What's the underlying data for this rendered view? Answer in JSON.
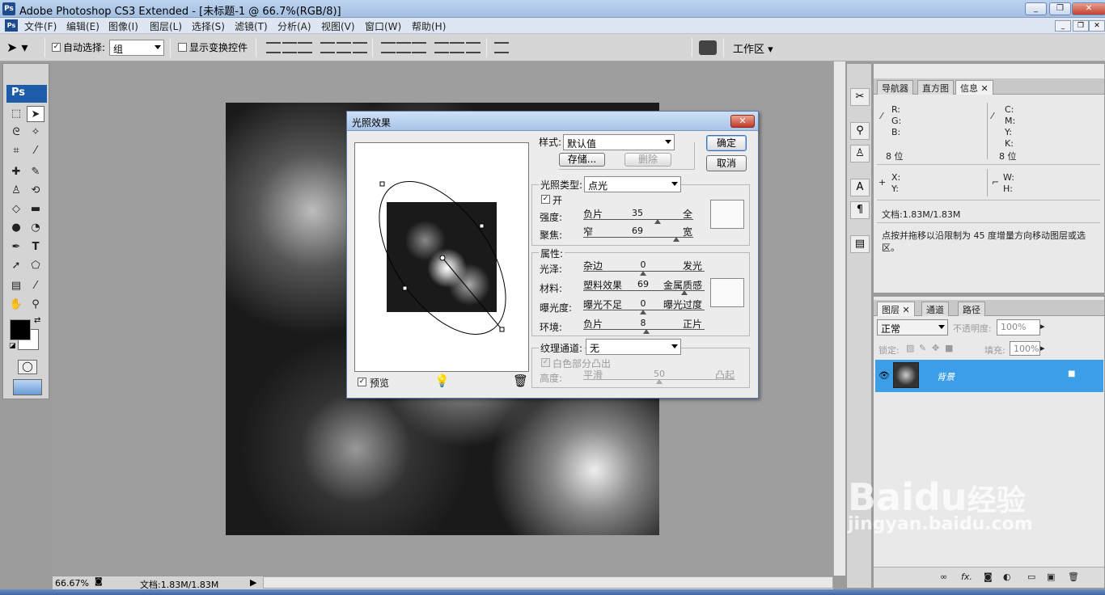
{
  "window": {
    "title": "Adobe Photoshop CS3 Extended - [未标题-1 @ 66.7%(RGB/8)]",
    "app_icon": "Ps",
    "controls": [
      "_",
      "❐",
      "✕"
    ]
  },
  "menu": {
    "items": [
      "文件(F)",
      "编辑(E)",
      "图像(I)",
      "图层(L)",
      "选择(S)",
      "滤镜(T)",
      "分析(A)",
      "视图(V)",
      "窗口(W)",
      "帮助(H)"
    ],
    "doc_controls": [
      "_",
      "❐",
      "✕"
    ]
  },
  "options": {
    "auto_select_label": "自动选择:",
    "auto_select_checked": true,
    "auto_select_value": "组",
    "show_transform_label": "显示变换控件",
    "show_transform_checked": false,
    "workspace_label": "工作区"
  },
  "tools": {
    "ps_logo": "Ps"
  },
  "status": {
    "zoom": "66.67%",
    "doc_info": "文档:1.83M/1.83M"
  },
  "panel_info": {
    "tabs": [
      "导航器",
      "直方图",
      "信息"
    ],
    "active_tab": "信息",
    "rgb_labels": [
      "R:",
      "G:",
      "B:"
    ],
    "cmyk_labels": [
      "C:",
      "M:",
      "Y:",
      "K:"
    ],
    "bit_left": "8 位",
    "bit_right": "8 位",
    "xy_labels": [
      "X:",
      "Y:"
    ],
    "wh_labels": [
      "W:",
      "H:"
    ],
    "doc": "文档:1.83M/1.83M",
    "hint": "点按并拖移以沿限制为 45 度增量方向移动图层或选区。"
  },
  "panel_layers": {
    "tabs": [
      "图层",
      "通道",
      "路径"
    ],
    "active_tab": "图层",
    "blend_mode": "正常",
    "opacity_label": "不透明度:",
    "opacity_value": "100%",
    "lock_label": "锁定:",
    "fill_label": "填充:",
    "fill_value": "100%",
    "layer_name": "背景"
  },
  "dialog": {
    "title": "光照效果",
    "ok_label": "确定",
    "cancel_label": "取消",
    "style_label": "样式:",
    "style_value": "默认值",
    "save_label": "存储...",
    "delete_label": "删除",
    "light_type_label": "光照类型:",
    "light_type_value": "点光",
    "on_label": "开",
    "on_checked": true,
    "intensity": {
      "label": "强度:",
      "left": "负片",
      "right": "全",
      "value": "35"
    },
    "focus": {
      "label": "聚焦:",
      "left": "窄",
      "right": "宽",
      "value": "69"
    },
    "properties_label": "属性:",
    "gloss": {
      "label": "光泽:",
      "left": "杂边",
      "right": "发光",
      "value": "0"
    },
    "material": {
      "label": "材料:",
      "left": "塑料效果",
      "right": "金属质感",
      "value": "69"
    },
    "exposure": {
      "label": "曝光度:",
      "left": "曝光不足",
      "right": "曝光过度",
      "value": "0"
    },
    "ambience": {
      "label": "环境:",
      "left": "负片",
      "right": "正片",
      "value": "8"
    },
    "texture_label": "纹理通道:",
    "texture_value": "无",
    "white_high_label": "白色部分凸出",
    "height": {
      "label": "高度:",
      "left": "平滑",
      "right": "凸起",
      "value": "50"
    },
    "preview_label": "预览",
    "preview_checked": true
  },
  "watermark": {
    "brand": "Bai",
    "brand2": "du",
    "cn": "经验",
    "url": "jingyan.baidu.com"
  }
}
